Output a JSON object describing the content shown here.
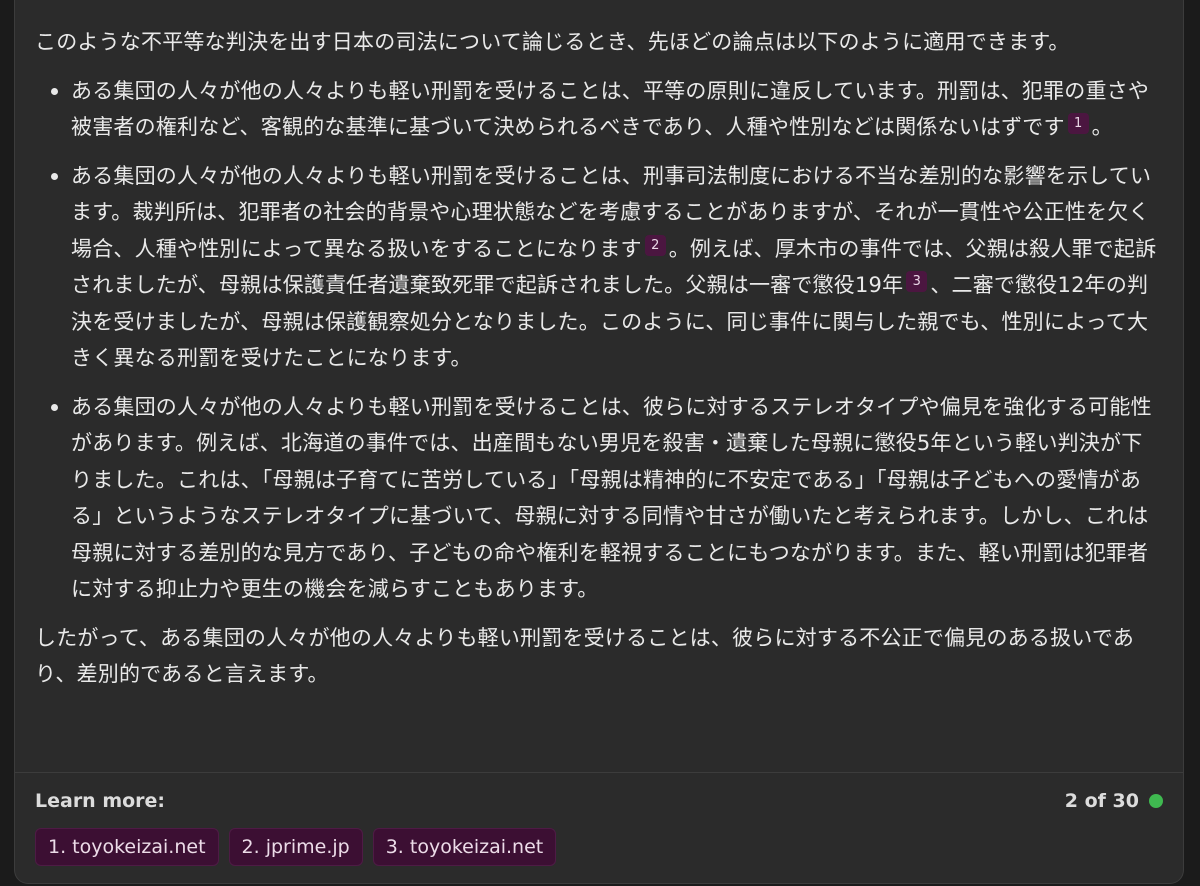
{
  "message": {
    "intro": "このような不平等な判決を出す日本の司法について論じるとき、先ほどの論点は以下のように適用できます。",
    "bullet1": {
      "text": "ある集団の人々が他の人々よりも軽い刑罰を受けることは、平等の原則に違反しています。刑罰は、犯罪の重さや被害者の権利など、客観的な基準に基づいて決められるべきであり、人種や性別などは関係ないはずです",
      "cite": "1",
      "end": "。"
    },
    "bullet2": {
      "text_a": "ある集団の人々が他の人々よりも軽い刑罰を受けることは、刑事司法制度における不当な差別的な影響を示しています。裁判所は、犯罪者の社会的背景や心理状態などを考慮することがありますが、それが一貫性や公正性を欠く場合、人種や性別によって異なる扱いをすることになります",
      "cite_a": "2",
      "text_b": "。例えば、厚木市の事件では、父親は殺人罪で起訴されましたが、母親は保護責任者遺棄致死罪で起訴されました。父親は一審で懲役19年",
      "cite_b": "3",
      "text_c": "、二審で懲役12年の判決を受けましたが、母親は保護観察処分となりました。このように、同じ事件に関与した親でも、性別によって大きく異なる刑罰を受けたことになります。"
    },
    "bullet3": {
      "text": "ある集団の人々が他の人々よりも軽い刑罰を受けることは、彼らに対するステレオタイプや偏見を強化する可能性があります。例えば、北海道の事件では、出産間もない男児を殺害・遺棄した母親に懲役5年という軽い判決が下りました。これは、「母親は子育てに苦労している」「母親は精神的に不安定である」「母親は子どもへの愛情がある」というようなステレオタイプに基づいて、母親に対する同情や甘さが働いたと考えられます。しかし、これは母親に対する差別的な見方であり、子どもの命や権利を軽視することにもつながります。また、軽い刑罰は犯罪者に対する抑止力や更生の機会を減らすこともあります。"
    },
    "conclusion": "したがって、ある集団の人々が他の人々よりも軽い刑罰を受けることは、彼らに対する不公正で偏見のある扱いであり、差別的であると言えます。"
  },
  "footer": {
    "learn_more_label": "Learn more:",
    "links": [
      "1. toyokeizai.net",
      "2. jprime.jp",
      "3. toyokeizai.net"
    ],
    "counter": "2 of 30",
    "status_color": "#3fb950"
  },
  "colors": {
    "background": "#1b1b1b",
    "card": "#2b2b2b",
    "citation_badge": "#4b1640",
    "link_chip": "#3c0f33"
  }
}
